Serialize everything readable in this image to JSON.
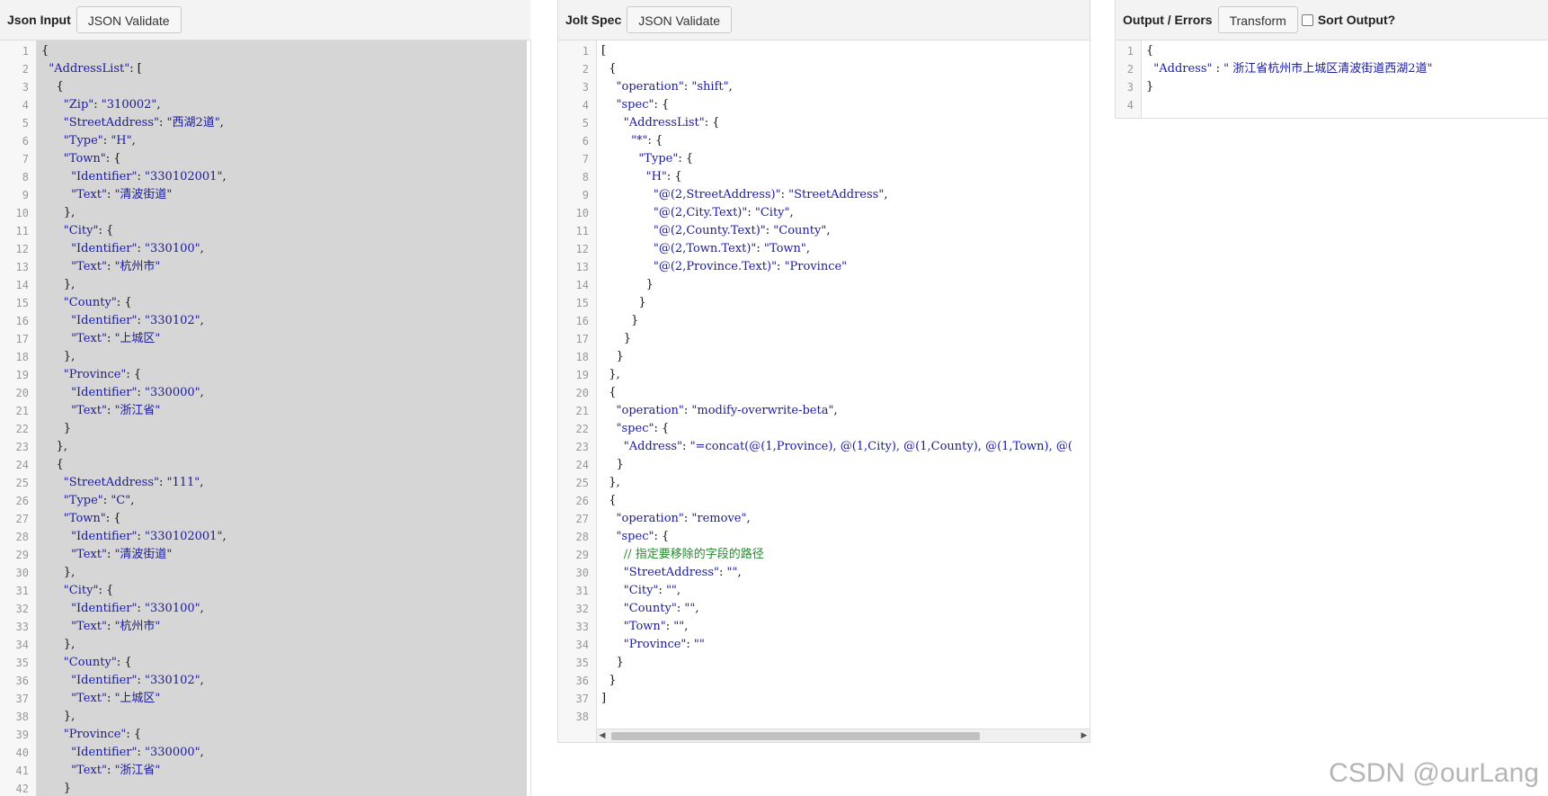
{
  "panels": {
    "input": {
      "title": "Json Input",
      "validate_label": "JSON Validate",
      "lines": [
        "{",
        "  \"AddressList\": [",
        "    {",
        "      \"Zip\": \"310002\",",
        "      \"StreetAddress\": \"西湖2道\",",
        "      \"Type\": \"H\",",
        "      \"Town\": {",
        "        \"Identifier\": \"330102001\",",
        "        \"Text\": \"清波街道\"",
        "      },",
        "      \"City\": {",
        "        \"Identifier\": \"330100\",",
        "        \"Text\": \"杭州市\"",
        "      },",
        "      \"County\": {",
        "        \"Identifier\": \"330102\",",
        "        \"Text\": \"上城区\"",
        "      },",
        "      \"Province\": {",
        "        \"Identifier\": \"330000\",",
        "        \"Text\": \"浙江省\"",
        "      }",
        "    },",
        "    {",
        "      \"StreetAddress\": \"111\",",
        "      \"Type\": \"C\",",
        "      \"Town\": {",
        "        \"Identifier\": \"330102001\",",
        "        \"Text\": \"清波街道\"",
        "      },",
        "      \"City\": {",
        "        \"Identifier\": \"330100\",",
        "        \"Text\": \"杭州市\"",
        "      },",
        "      \"County\": {",
        "        \"Identifier\": \"330102\",",
        "        \"Text\": \"上城区\"",
        "      },",
        "      \"Province\": {",
        "        \"Identifier\": \"330000\",",
        "        \"Text\": \"浙江省\"",
        "      }"
      ]
    },
    "spec": {
      "title": "Jolt Spec",
      "validate_label": "JSON Validate",
      "lines": [
        "[",
        "  {",
        "    \"operation\": \"shift\",",
        "    \"spec\": {",
        "      \"AddressList\": {",
        "        \"*\": {",
        "          \"Type\": {",
        "            \"H\": {",
        "              \"@(2,StreetAddress)\": \"StreetAddress\",",
        "              \"@(2,City.Text)\": \"City\",",
        "              \"@(2,County.Text)\": \"County\",",
        "              \"@(2,Town.Text)\": \"Town\",",
        "              \"@(2,Province.Text)\": \"Province\"",
        "            }",
        "          }",
        "        }",
        "      }",
        "    }",
        "  },",
        "  {",
        "    \"operation\": \"modify-overwrite-beta\",",
        "    \"spec\": {",
        "      \"Address\": \"=concat(@(1,Province), @(1,City), @(1,County), @(1,Town), @(",
        "    }",
        "  },",
        "  {",
        "    \"operation\": \"remove\",",
        "    \"spec\": {",
        "      // 指定要移除的字段的路径",
        "      \"StreetAddress\": \"\",",
        "      \"City\": \"\",",
        "      \"County\": \"\",",
        "      \"Town\": \"\",",
        "      \"Province\": \"\"",
        "    }",
        "  }",
        "]",
        ""
      ]
    },
    "output": {
      "title": "Output / Errors",
      "transform_label": "Transform",
      "sort_label": "Sort Output?",
      "sort_checked": false,
      "lines": [
        "{",
        "  \"Address\" : \" 浙江省杭州市上城区清波街道西湖2道\"",
        "}",
        ""
      ]
    }
  },
  "watermark": "CSDN @ourLang",
  "colors": {
    "selection_bg": "#d6d6d6",
    "string": "#1a1aa6",
    "comment": "#238b2c"
  }
}
